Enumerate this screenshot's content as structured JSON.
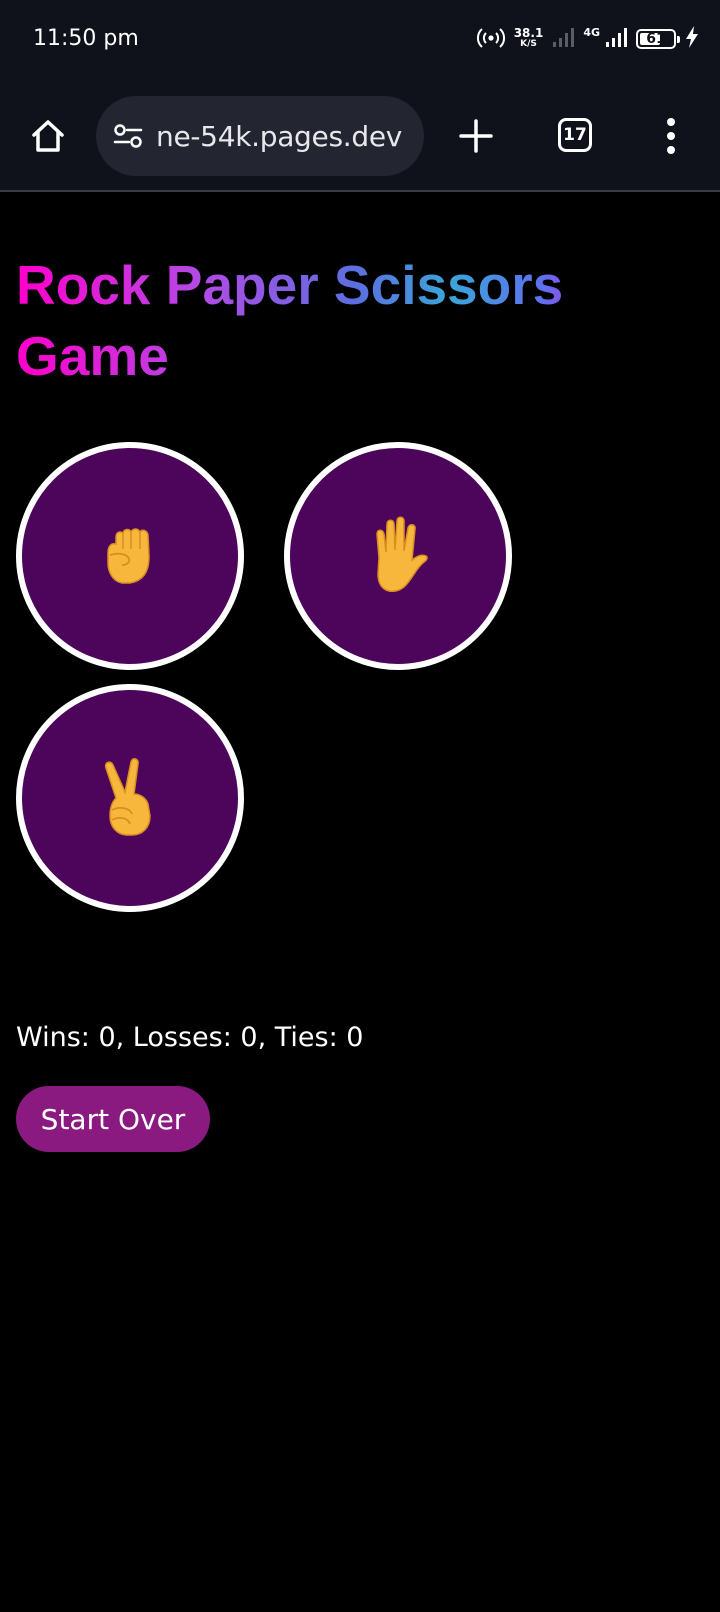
{
  "status_bar": {
    "time": "11:50 pm",
    "net_speed_value": "38.1",
    "net_speed_unit": "K/S",
    "network_type": "4G",
    "battery_level": "61",
    "icons": [
      "hotspot-icon",
      "signal-weak-icon",
      "signal-strong-icon",
      "battery-icon",
      "charging-icon"
    ]
  },
  "browser": {
    "url": "ne-54k.pages.dev",
    "tab_count": "17",
    "icons": [
      "home-icon",
      "site-settings-icon",
      "plus-icon",
      "tabs-icon",
      "more-vert-icon"
    ]
  },
  "game": {
    "title": "Rock Paper Scissors Game",
    "choices": [
      {
        "name": "rock",
        "emoji": "✊"
      },
      {
        "name": "paper",
        "emoji": "🖐"
      },
      {
        "name": "scissors",
        "emoji": "✌"
      }
    ],
    "score_text": "Wins: 0, Losses: 0, Ties: 0",
    "start_over_label": "Start Over"
  },
  "colors": {
    "background": "#000000",
    "choice_fill": "#4d055c",
    "choice_border": "#ffffff",
    "start_over_bg": "#8b1a80",
    "title_gradient": [
      "#ff00cc",
      "#b14be6",
      "#5b6fe0",
      "#3aa6d8"
    ],
    "chrome_bg": "#0f121a",
    "url_bar_bg": "#232630"
  }
}
